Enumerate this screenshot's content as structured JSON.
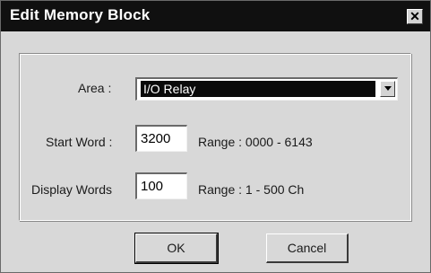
{
  "dialog": {
    "title": "Edit Memory Block",
    "close_label": "✕"
  },
  "form": {
    "area_label": "Area :",
    "area_value": "I/O Relay",
    "start_word_label": "Start Word :",
    "start_word_value": "3200",
    "start_word_range": "Range : 0000 - 6143",
    "display_words_label": "Display Words",
    "display_words_value": "100",
    "display_words_range": "Range : 1 - 500 Ch"
  },
  "buttons": {
    "ok_label": "OK",
    "cancel_label": "Cancel"
  },
  "colors": {
    "titlebar": "#101010",
    "dialog_bg": "#d8d8d8",
    "selection": "#0a0a0a"
  }
}
